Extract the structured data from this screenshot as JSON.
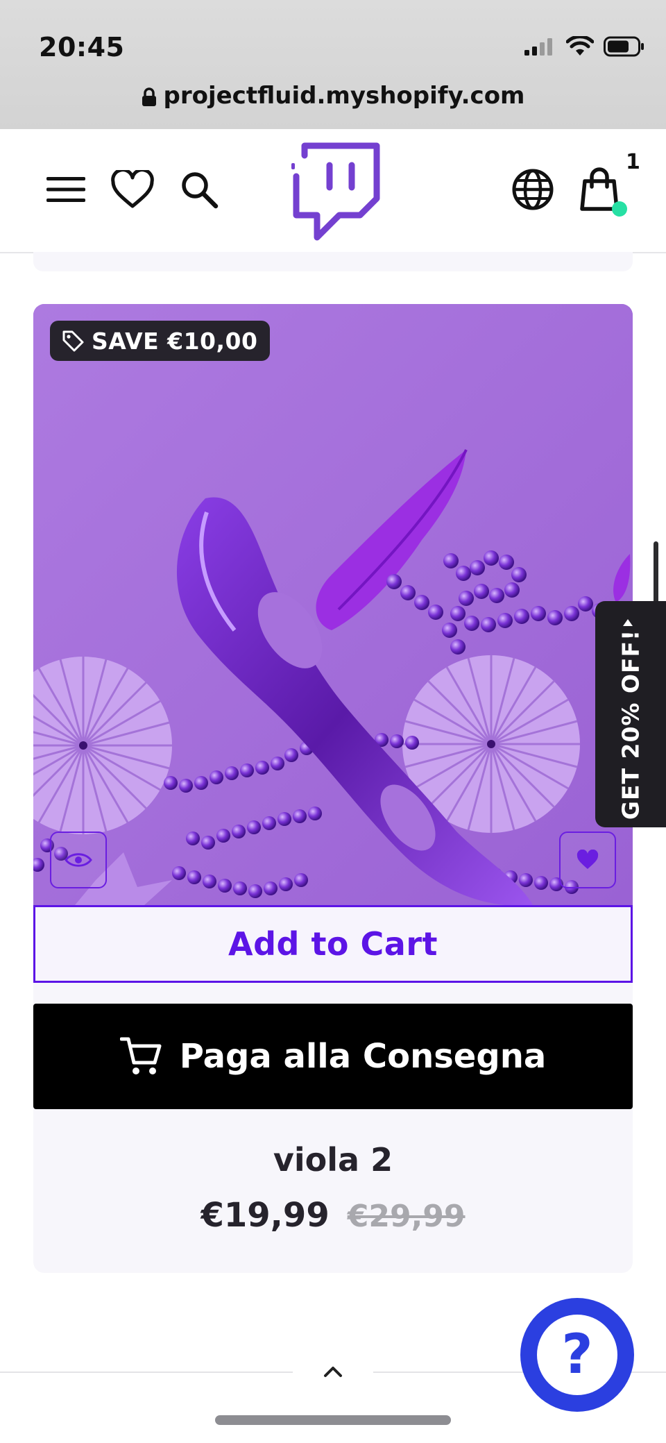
{
  "status_bar": {
    "time": "20:45",
    "url": "projectfluid.myshopify.com",
    "icons": [
      "signal-icon",
      "wifi-icon",
      "battery-icon"
    ]
  },
  "header": {
    "icons": [
      "menu-icon",
      "heart-icon",
      "search-icon",
      "globe-icon",
      "shopping-bag-icon"
    ],
    "cart_count": "1",
    "brand_color": "#7440d0"
  },
  "product": {
    "badge": "SAVE €10,00",
    "add_to_cart_label": "Add to Cart",
    "cod_label": "Paga alla Consegna",
    "title": "viola 2",
    "price": "€19,99",
    "compare_price": "€29,99",
    "accent_color": "#5c14e6"
  },
  "promo": {
    "label": "GET 20% OFF!"
  },
  "help": {
    "label": "?"
  }
}
